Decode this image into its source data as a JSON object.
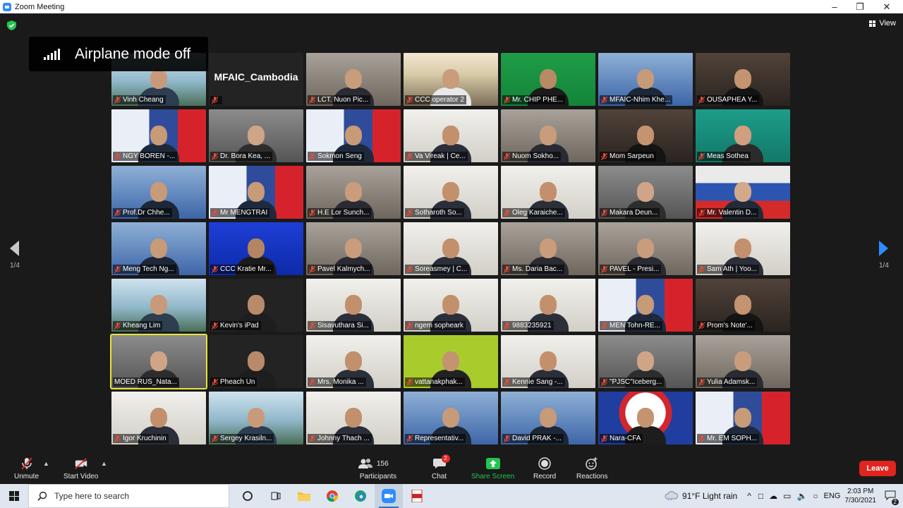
{
  "window": {
    "title": "Zoom Meeting",
    "controls": [
      "minimize",
      "maximize",
      "close"
    ]
  },
  "top_bar": {
    "view_label": "View"
  },
  "toast": {
    "text": "Airplane mode off"
  },
  "navigation": {
    "prev_page": "1/4",
    "next_page": "1/4"
  },
  "participants_grid": [
    {
      "name": "Vinh Cheang",
      "scene": "beach",
      "muted": true,
      "video": true
    },
    {
      "name": "",
      "display_text": "MFAIC_Cambodia",
      "scene": "dark",
      "muted": true,
      "video": false
    },
    {
      "name": "LCT. Nuon Pic...",
      "scene": "office",
      "muted": true,
      "video": true
    },
    {
      "name": "CCC operator 2",
      "scene": "stage",
      "muted": true,
      "video": true
    },
    {
      "name": "Mr. CHIP PHE...",
      "scene": "green",
      "muted": true,
      "video": true
    },
    {
      "name": "MFAIC-Nhim Khe...",
      "scene": "blue",
      "muted": true,
      "video": true
    },
    {
      "name": "OUSAPHEA Y...",
      "scene": "darkroom",
      "muted": true,
      "video": true
    },
    {
      "name": "NGY BOREN -...",
      "scene": "banner",
      "muted": true,
      "video": true
    },
    {
      "name": "Dr. Bora Kea, ...",
      "scene": "grey",
      "muted": true,
      "video": true
    },
    {
      "name": "Sokmon Seng",
      "scene": "banner",
      "muted": true,
      "video": true
    },
    {
      "name": "Va Vireak | Ce...",
      "scene": "white",
      "muted": true,
      "video": true
    },
    {
      "name": "Nuom Sokho...",
      "scene": "office",
      "muted": true,
      "video": true
    },
    {
      "name": "Mom Sarpeun",
      "scene": "darkroom",
      "muted": true,
      "video": true
    },
    {
      "name": "Meas Sothea",
      "scene": "teal",
      "muted": true,
      "video": true
    },
    {
      "name": "Prof.Dr Chhe...",
      "scene": "blue",
      "muted": true,
      "video": true
    },
    {
      "name": "Mr MENGTRAI",
      "scene": "banner",
      "muted": true,
      "video": true
    },
    {
      "name": "H.E Lor Sunch...",
      "scene": "office",
      "muted": true,
      "video": true
    },
    {
      "name": "Sotharoth So...",
      "scene": "white",
      "muted": true,
      "video": true
    },
    {
      "name": "Oleg Karaiche...",
      "scene": "white",
      "muted": true,
      "video": true
    },
    {
      "name": "Makara Deun...",
      "scene": "grey",
      "muted": true,
      "video": true
    },
    {
      "name": "Mr. Valentin D...",
      "scene": "flag",
      "muted": true,
      "video": true
    },
    {
      "name": "Meng Tech Ng...",
      "scene": "blue",
      "muted": true,
      "video": true
    },
    {
      "name": "CCC Kratie Mr...",
      "scene": "brightblue",
      "muted": true,
      "video": true
    },
    {
      "name": "Pavel Kalmych...",
      "scene": "office",
      "muted": true,
      "video": true
    },
    {
      "name": "Soreasmey | C...",
      "scene": "white",
      "muted": true,
      "video": true
    },
    {
      "name": "Ms. Daria Bac...",
      "scene": "office",
      "muted": true,
      "video": true
    },
    {
      "name": "PAVEL - Presi...",
      "scene": "office",
      "muted": true,
      "video": true
    },
    {
      "name": "Sam Ath | Yoo...",
      "scene": "white",
      "muted": true,
      "video": true
    },
    {
      "name": "Kheang Lim",
      "scene": "beach",
      "muted": true,
      "video": true
    },
    {
      "name": "Kevin's iPad",
      "scene": "dark",
      "muted": true,
      "video": true
    },
    {
      "name": "Sisavuthara Si...",
      "scene": "white",
      "muted": true,
      "video": true
    },
    {
      "name": "ngem sopheark",
      "scene": "white",
      "muted": true,
      "video": true
    },
    {
      "name": "9883235921",
      "scene": "white",
      "muted": true,
      "video": true
    },
    {
      "name": "MEN Tohn-RE...",
      "scene": "banner",
      "muted": true,
      "video": true
    },
    {
      "name": "Prom's Note'...",
      "scene": "darkroom",
      "muted": true,
      "video": true
    },
    {
      "name": "MOED RUS_Nata...",
      "scene": "grey",
      "muted": false,
      "video": true,
      "active": true
    },
    {
      "name": "Pheach Un",
      "scene": "dark",
      "muted": true,
      "video": true
    },
    {
      "name": "Mrs. Monika ...",
      "scene": "white",
      "muted": true,
      "video": true
    },
    {
      "name": "vattanakphak...",
      "scene": "lime",
      "muted": true,
      "video": true
    },
    {
      "name": "Kennie Sang -...",
      "scene": "white",
      "muted": true,
      "video": true
    },
    {
      "name": "\"PJSC\"Iceberg...",
      "scene": "grey",
      "muted": true,
      "video": true
    },
    {
      "name": "Yulia Adamsk...",
      "scene": "office",
      "muted": true,
      "video": true
    },
    {
      "name": "Igor Kruchinin",
      "scene": "white",
      "muted": true,
      "video": true
    },
    {
      "name": "Sergey Krasiln...",
      "scene": "beach",
      "muted": true,
      "video": true
    },
    {
      "name": "Johnny Thach ...",
      "scene": "white",
      "muted": true,
      "video": true
    },
    {
      "name": "Representativ...",
      "scene": "blue",
      "muted": true,
      "video": true
    },
    {
      "name": "David PRAK -...",
      "scene": "blue",
      "muted": true,
      "video": true
    },
    {
      "name": "Nara-CFA",
      "scene": "logo",
      "muted": true,
      "video": true
    },
    {
      "name": "Mr. EM SOPH...",
      "scene": "banner",
      "muted": true,
      "video": true
    }
  ],
  "toolbar": {
    "unmute": "Unmute",
    "start_video": "Start Video",
    "participants": "Participants",
    "participants_count": "156",
    "chat": "Chat",
    "chat_badge": "2",
    "share_screen": "Share Screen",
    "record": "Record",
    "reactions": "Reactions",
    "leave": "Leave"
  },
  "taskbar": {
    "search_placeholder": "Type here to search",
    "weather": "91°F  Light rain",
    "language": "ENG",
    "time": "2:03 PM",
    "date": "7/30/2021",
    "notifications": "2"
  },
  "colors": {
    "zoom_blue": "#2d8cff",
    "leave_red": "#e0241e",
    "share_green": "#23c552",
    "active_speaker": "#e6e63a"
  }
}
